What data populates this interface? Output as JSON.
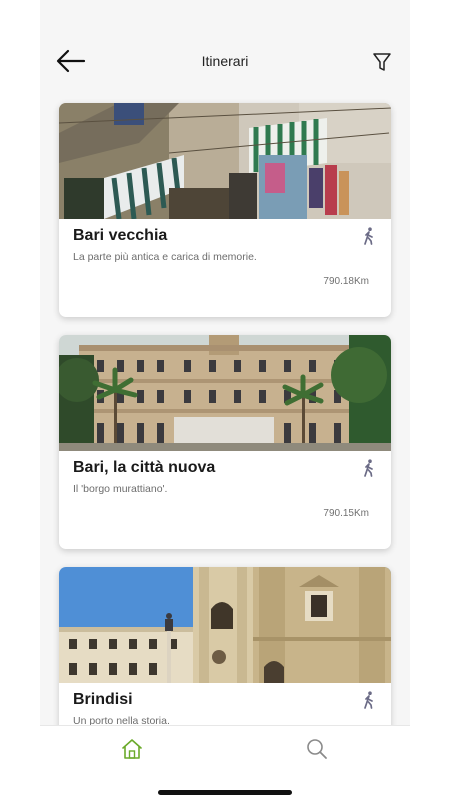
{
  "header": {
    "title": "Itinerari",
    "back_icon": "arrow-left-icon",
    "filter_icon": "funnel-filter-icon"
  },
  "itineraries": [
    {
      "title": "Bari vecchia",
      "subtitle": "La parte più antica e carica di memorie.",
      "distance": "790.18Km",
      "mode_icon": "walking-icon"
    },
    {
      "title": "Bari, la città nuova",
      "subtitle": "Il 'borgo murattiano'.",
      "distance": "790.15Km",
      "mode_icon": "walking-icon"
    },
    {
      "title": "Brindisi",
      "subtitle": "Un porto nella storia.",
      "mode_icon": "walking-icon"
    }
  ],
  "tabbar": {
    "items": [
      {
        "icon": "home-icon",
        "active": true
      },
      {
        "icon": "search-icon",
        "active": false
      }
    ],
    "accent_color": "#6aaa2a"
  }
}
